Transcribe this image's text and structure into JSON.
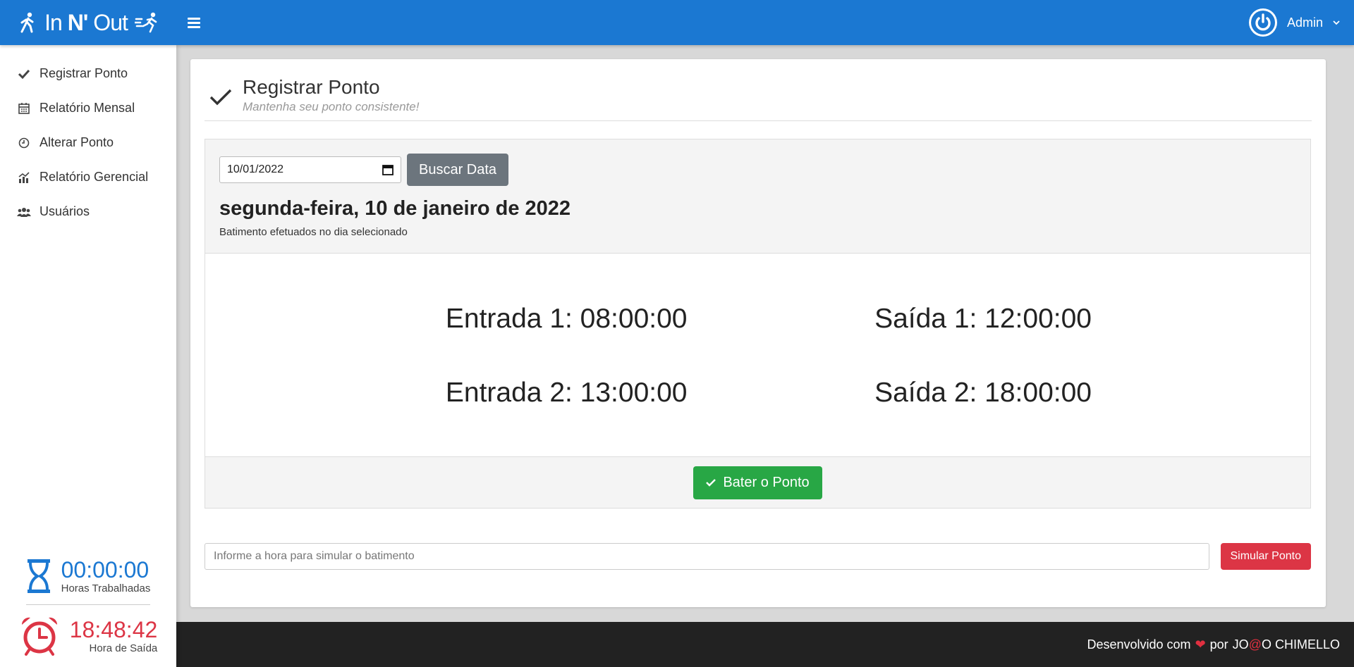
{
  "header": {
    "logo_in": "In",
    "logo_n": "N'",
    "logo_out": "Out",
    "user_name": "Admin"
  },
  "sidebar": {
    "items": [
      {
        "label": "Registrar Ponto",
        "icon": "check-icon"
      },
      {
        "label": "Relatório Mensal",
        "icon": "calendar-icon"
      },
      {
        "label": "Alterar Ponto",
        "icon": "clock-icon"
      },
      {
        "label": "Relatório Gerencial",
        "icon": "chart-icon"
      },
      {
        "label": "Usuários",
        "icon": "users-icon"
      }
    ],
    "worked_hours": {
      "value": "00:00:00",
      "label": "Horas Trabalhadas",
      "color": "#1b78d2"
    },
    "exit_time": {
      "value": "18:48:42",
      "label": "Hora de Saída",
      "color": "#dc3545"
    }
  },
  "page": {
    "title": "Registrar Ponto",
    "subtitle": "Mantenha seu ponto consistente!"
  },
  "search": {
    "date_value": "10/01/2022",
    "button_label": "Buscar Data"
  },
  "day": {
    "title": "segunda-feira, 10 de janeiro de 2022",
    "subtitle": "Batimento efetuados no dia selecionado"
  },
  "punches": {
    "entrada1": "Entrada 1: 08:00:00",
    "saida1": "Saída 1: 12:00:00",
    "entrada2": "Entrada 2: 13:00:00",
    "saida2": "Saída 2: 18:00:00"
  },
  "punch_button": "Bater o Ponto",
  "simulate": {
    "placeholder": "Informe a hora para simular o batimento",
    "button_label": "Simular Ponto"
  },
  "footer": {
    "prefix": "Desenvolvido com",
    "heart": "❤",
    "by": "por",
    "name_a": "JO",
    "name_at": "@",
    "name_b": "O CHIMELLO"
  },
  "colors": {
    "header": "#1b78d2",
    "success": "#28a745",
    "danger": "#dc3545",
    "secondary": "#6c757d",
    "footer": "#222222"
  }
}
